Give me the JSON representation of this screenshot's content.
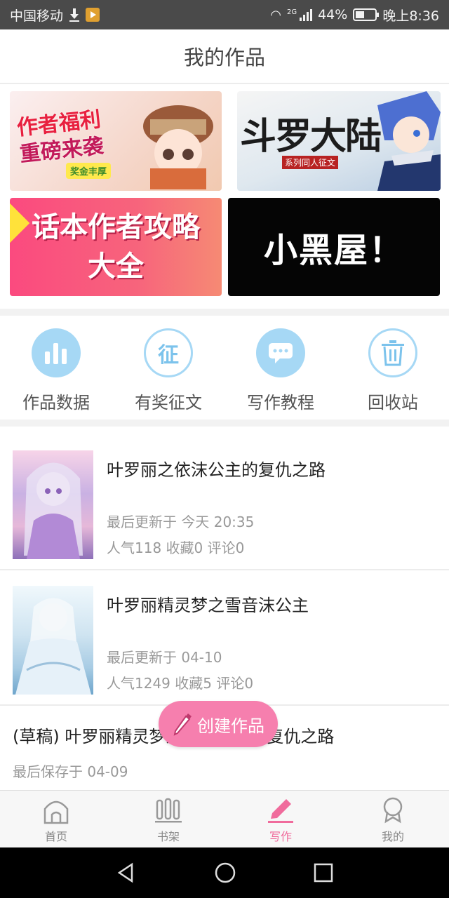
{
  "status_bar": {
    "carrier": "中国移动",
    "network": "2G",
    "battery": "44%",
    "time": "晚上8:36"
  },
  "header": {
    "title": "我的作品"
  },
  "banners": [
    {
      "line1": "作者福利",
      "line2": "重磅来袭",
      "tag": "奖金丰厚"
    },
    {
      "title": "斗罗大陆",
      "subtitle": "系列同人征文"
    },
    {
      "line1": "话本作者攻略",
      "line2": "大全"
    },
    {
      "text": "小黑屋！"
    }
  ],
  "quick_actions": [
    {
      "label": "作品数据",
      "icon": "bar-chart-icon"
    },
    {
      "label": "有奖征文",
      "icon": "zheng-badge-icon",
      "glyph": "征"
    },
    {
      "label": "写作教程",
      "icon": "chat-bubble-icon"
    },
    {
      "label": "回收站",
      "icon": "trash-icon"
    }
  ],
  "works": [
    {
      "title": "叶罗丽之依沫公主的复仇之路",
      "updated": "最后更新于 今天 20:35",
      "stats": "人气118  收藏0  评论0"
    },
    {
      "title": "叶罗丽精灵梦之雪音沫公主",
      "updated": "最后更新于 04-10",
      "stats": "人气1249  收藏5  评论0"
    }
  ],
  "draft": {
    "title": "(草稿) 叶罗丽精灵梦之依沫公主的复仇之路",
    "saved": "最后保存于 04-09"
  },
  "fab": {
    "label": "创建作品"
  },
  "bottom_nav": [
    {
      "label": "首页",
      "icon": "home-icon"
    },
    {
      "label": "书架",
      "icon": "bookshelf-icon"
    },
    {
      "label": "写作",
      "icon": "pencil-icon",
      "active": true
    },
    {
      "label": "我的",
      "icon": "profile-icon"
    }
  ],
  "colors": {
    "accent": "#f06b9c",
    "fab": "#f67fae",
    "icon_blue": "#a6d8f5"
  }
}
